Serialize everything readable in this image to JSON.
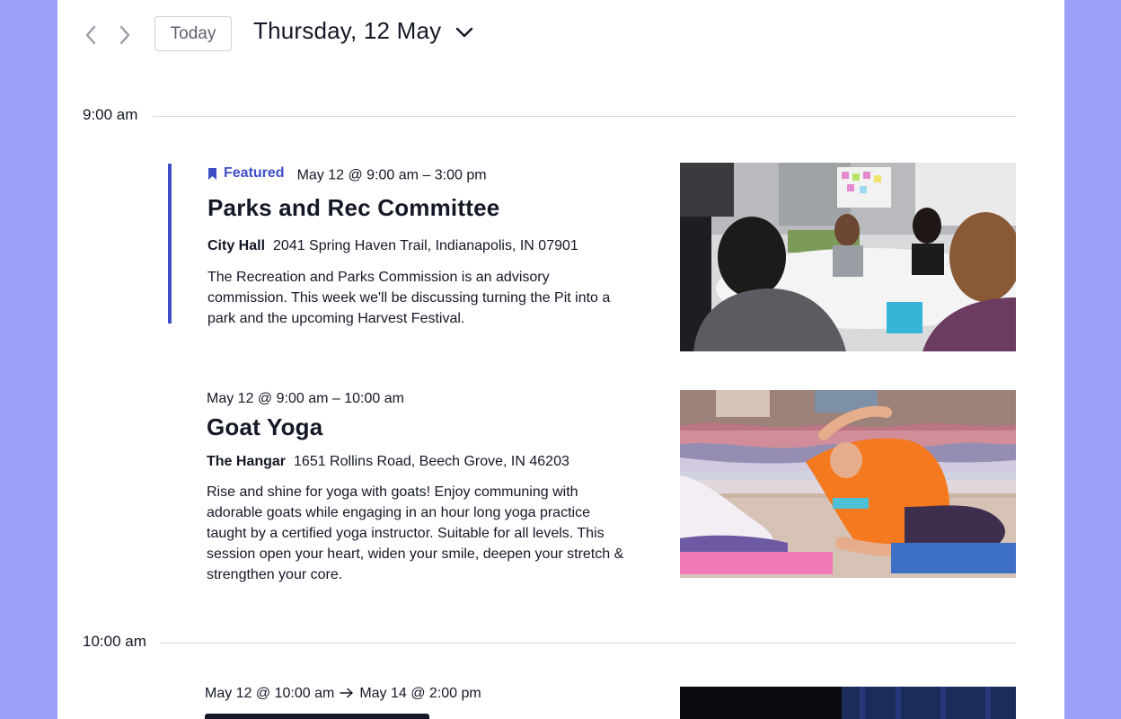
{
  "toolbar": {
    "today_label": "Today",
    "date_label": "Thursday, 12 May"
  },
  "time_groups": [
    {
      "label": "9:00 am"
    },
    {
      "label": "10:00 am"
    }
  ],
  "events": [
    {
      "featured_label": "Featured",
      "datetime": "May 12 @ 9:00 am – 3:00 pm",
      "title": "Parks and Rec Committee",
      "venue_name": "City Hall",
      "venue_address": "2041 Spring Haven Trail, Indianapolis, IN 07901",
      "description": "The Recreation and Parks Commission is an advisory commission. This week we'll be discussing turning the Pit into a park and the upcoming Harvest Festival."
    },
    {
      "datetime": "May 12 @ 9:00 am – 10:00 am",
      "title": "Goat Yoga",
      "venue_name": "The Hangar",
      "venue_address": "1651 Rollins Road, Beech Grove, IN 46203",
      "description": "Rise and shine for yoga with goats! Enjoy communing with adorable goats while engaging in an hour long yoga practice taught by a certified yoga instructor. Suitable for all levels. This session open your heart, widen your smile, deepen your stretch & strengthen your core."
    },
    {
      "datetime_start": "May 12 @ 10:00 am",
      "datetime_end": "May 14 @ 2:00 pm"
    }
  ],
  "icons": {
    "prev": "chevron-left-icon",
    "next": "chevron-right-icon",
    "date_picker": "chevron-down-icon",
    "featured": "bookmark-icon",
    "range": "arrow-right-icon"
  },
  "colors": {
    "page_background": "#9b9ff7",
    "accent": "#3d4ec6",
    "text": "#141827"
  }
}
